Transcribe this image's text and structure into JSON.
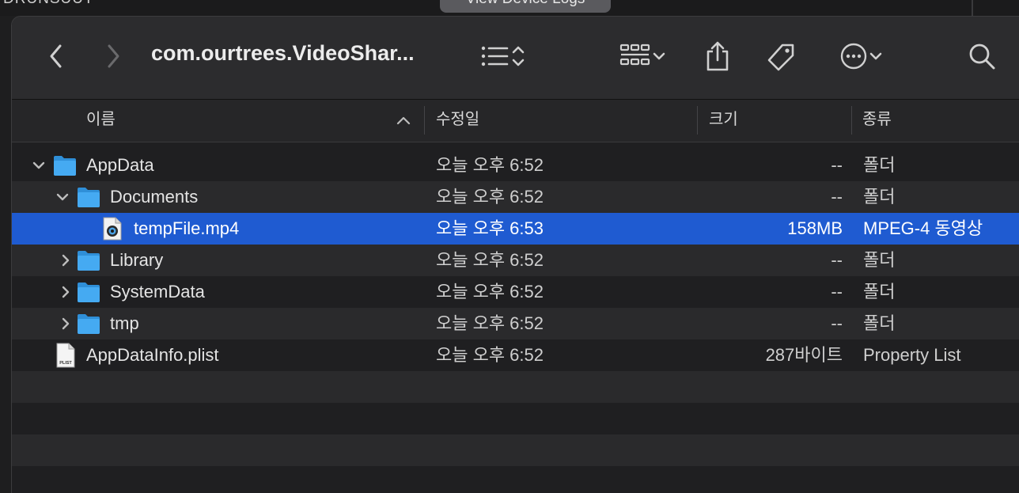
{
  "background": {
    "partial_text": "DRUNSUUT",
    "log_button": "View Device Logs"
  },
  "toolbar": {
    "title": "com.ourtrees.VideoShar...",
    "icons": [
      "chevron-left-icon",
      "chevron-right-icon",
      "list-view-icon",
      "sort-arrows-icon",
      "icon-grid-icon",
      "chevron-down-icon",
      "share-icon",
      "tag-icon",
      "more-icon",
      "search-icon"
    ]
  },
  "columns": {
    "name": "이름",
    "modified": "수정일",
    "size": "크기",
    "kind": "종류"
  },
  "rows": [
    {
      "name": "AppData",
      "date": "오늘 오후 6:52",
      "size": "--",
      "kind": "폴더",
      "level": 0,
      "disclosure": "expanded",
      "icon": "folder"
    },
    {
      "name": "Documents",
      "date": "오늘 오후 6:52",
      "size": "--",
      "kind": "폴더",
      "level": 1,
      "disclosure": "expanded",
      "icon": "folder"
    },
    {
      "name": "tempFile.mp4",
      "date": "오늘 오후 6:53",
      "size": "158MB",
      "kind": "MPEG-4 동영상",
      "level": 2,
      "disclosure": "none",
      "icon": "video",
      "selected": true
    },
    {
      "name": "Library",
      "date": "오늘 오후 6:52",
      "size": "--",
      "kind": "폴더",
      "level": 1,
      "disclosure": "collapsed",
      "icon": "folder"
    },
    {
      "name": "SystemData",
      "date": "오늘 오후 6:52",
      "size": "--",
      "kind": "폴더",
      "level": 1,
      "disclosure": "collapsed",
      "icon": "folder"
    },
    {
      "name": "tmp",
      "date": "오늘 오후 6:52",
      "size": "--",
      "kind": "폴더",
      "level": 1,
      "disclosure": "collapsed",
      "icon": "folder"
    },
    {
      "name": "AppDataInfo.plist",
      "date": "오늘 오후 6:52",
      "size": "287바이트",
      "kind": "Property List",
      "level": 0,
      "disclosure": "none",
      "icon": "plist"
    }
  ],
  "plist_badge": "PLIST",
  "colors": {
    "selection": "#1f5bd1",
    "folder": "#3fa9f5",
    "toolbar": "#2c2c2e"
  }
}
